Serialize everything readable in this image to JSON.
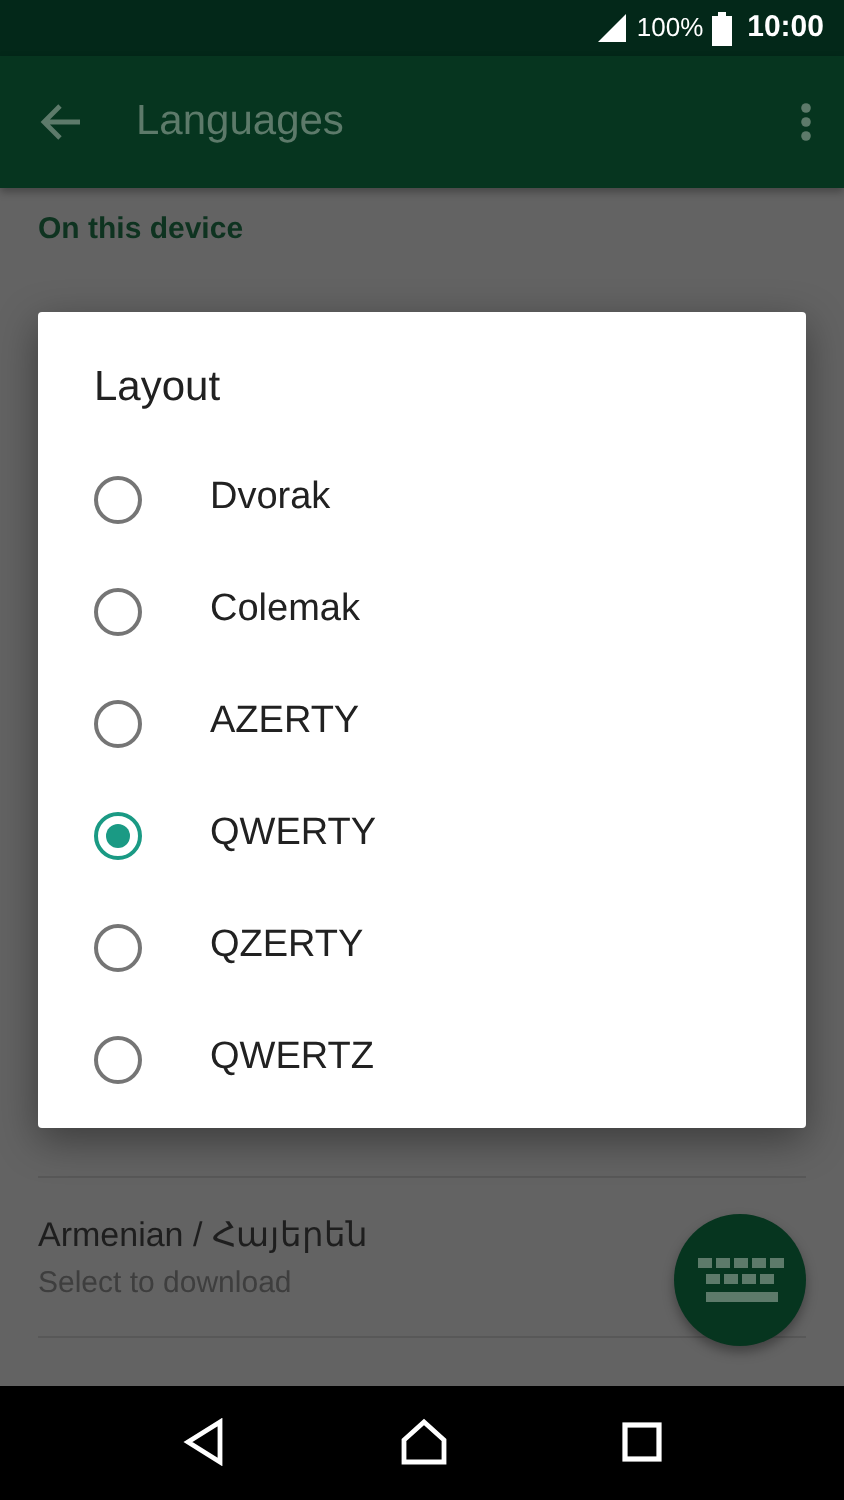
{
  "status_bar": {
    "battery": "100%",
    "time": "10:00"
  },
  "app_bar": {
    "title": "Languages"
  },
  "section": {
    "title": "On this device"
  },
  "languages": [
    {
      "name": "Armenian / Հայերեն",
      "subtitle": "Select to download"
    }
  ],
  "dialog": {
    "title": "Layout",
    "options": [
      {
        "label": "Dvorak",
        "selected": false
      },
      {
        "label": "Colemak",
        "selected": false
      },
      {
        "label": "AZERTY",
        "selected": false
      },
      {
        "label": "QWERTY",
        "selected": true
      },
      {
        "label": "QZERTY",
        "selected": false
      },
      {
        "label": "QWERTZ",
        "selected": false
      }
    ]
  }
}
